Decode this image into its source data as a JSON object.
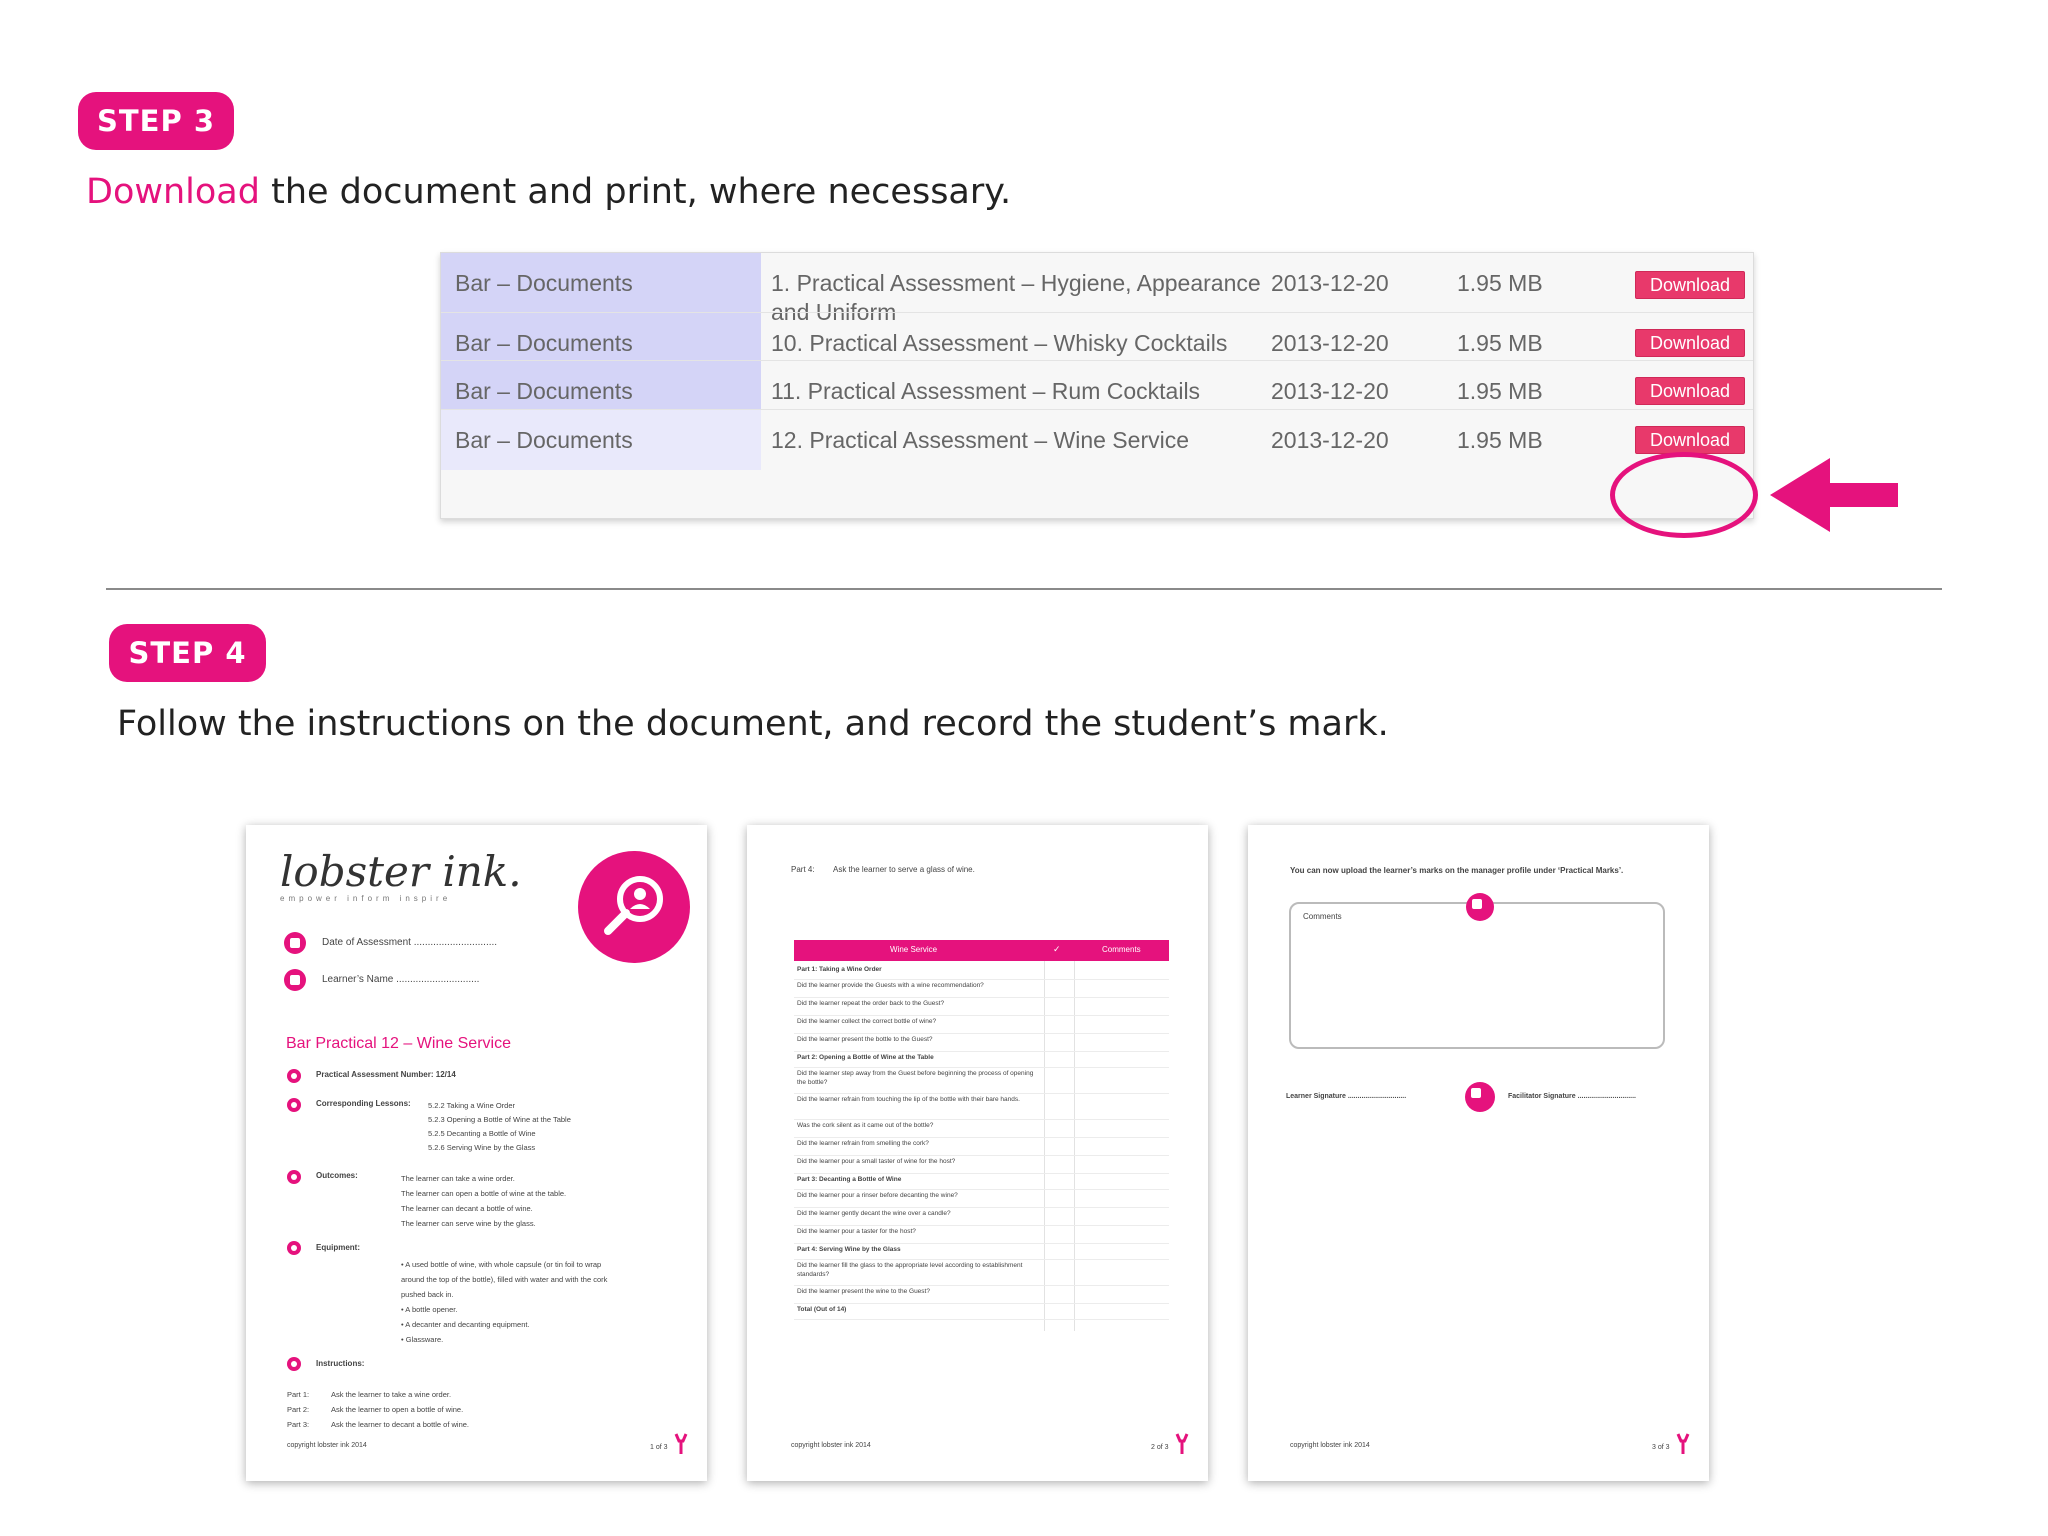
{
  "step3": {
    "badge": "STEP 3",
    "instruction_link": "Download",
    "instruction_rest": " the document and print, where necessary."
  },
  "table": {
    "rows": [
      {
        "category": "Bar – Documents",
        "title": "1. Practical Assessment – Hygiene, Appearance and Uniform",
        "date": "2013-12-20",
        "size": "1.95 MB",
        "button": "Download"
      },
      {
        "category": "Bar – Documents",
        "title": "10. Practical Assessment – Whisky Cocktails",
        "date": "2013-12-20",
        "size": "1.95 MB",
        "button": "Download"
      },
      {
        "category": "Bar – Documents",
        "title": "11. Practical Assessment – Rum Cocktails",
        "date": "2013-12-20",
        "size": "1.95 MB",
        "button": "Download"
      },
      {
        "category": "Bar – Documents",
        "title": "12. Practical Assessment – Wine Service",
        "date": "2013-12-20",
        "size": "1.95 MB",
        "button": "Download"
      }
    ]
  },
  "step4": {
    "badge": "STEP 4",
    "instruction": "Follow the instructions on the document, and record the student’s mark."
  },
  "page1": {
    "logo_text": "lobster ink.",
    "logo_tagline": "empower inform inspire",
    "date_label": "Date of Assessment ..............................",
    "name_label": "Learner’s Name ..............................",
    "doc_title": "Bar Practical 12 – Wine Service",
    "assessment_number": "Practical Assessment Number: 12/14",
    "corresponding_label": "Corresponding Lessons:",
    "lessons": [
      "5.2.2 Taking a Wine Order",
      "5.2.3 Opening a Bottle of Wine at the Table",
      "5.2.5 Decanting a Bottle of Wine",
      "5.2.6 Serving Wine by the Glass"
    ],
    "outcomes_label": "Outcomes:",
    "outcomes": [
      "The learner can take a wine order.",
      "The learner can open a bottle of wine at the table.",
      "The learner can decant a bottle of wine.",
      "The learner can serve wine by the glass."
    ],
    "equipment_label": "Equipment:",
    "equipment": [
      "• A used bottle of wine, with whole capsule (or tin foil to wrap",
      "around the top of the bottle), filled with water and with the cork",
      "pushed back in.",
      "• A bottle opener.",
      "• A decanter and decanting equipment.",
      "• Glassware."
    ],
    "instructions_label": "Instructions:",
    "instructions": [
      {
        "part": "Part 1:",
        "text": "Ask the learner to take a wine order."
      },
      {
        "part": "Part 2:",
        "text": "Ask the learner to open a bottle of wine."
      },
      {
        "part": "Part 3:",
        "text": "Ask the learner to decant a bottle of wine."
      }
    ],
    "copyright": "copyright lobster ink 2014",
    "page_num": "1 of 3"
  },
  "page2": {
    "part4_label": "Part 4:",
    "part4_text": "Ask the learner to serve a glass of wine.",
    "col1": "Wine Service",
    "col2": "✓",
    "col3": "Comments",
    "rows": [
      {
        "text": "Part 1: Taking a Wine Order",
        "bold": true
      },
      {
        "text": "Did the learner provide the Guests with a wine recommendation?",
        "bold": false
      },
      {
        "text": "Did the learner repeat the order back to the Guest?",
        "bold": false
      },
      {
        "text": "Did the learner collect the correct bottle of wine?",
        "bold": false
      },
      {
        "text": "Did the learner present the bottle to the Guest?",
        "bold": false
      },
      {
        "text": "Part 2: Opening a Bottle of Wine at the Table",
        "bold": true
      },
      {
        "text": "Did the learner step away from the Guest before beginning the process of opening the bottle?",
        "bold": false
      },
      {
        "text": "Did the learner refrain from touching the lip of the bottle with their bare hands.",
        "bold": false
      },
      {
        "text": "Was the cork silent as it came out of the bottle?",
        "bold": false
      },
      {
        "text": "Did the learner refrain from smelling the cork?",
        "bold": false
      },
      {
        "text": "Did the learner pour a small taster of wine for the host?",
        "bold": false
      },
      {
        "text": "Part 3: Decanting a Bottle of Wine",
        "bold": true
      },
      {
        "text": "Did the learner pour a rinser before decanting the wine?",
        "bold": false
      },
      {
        "text": "Did the learner gently decant the wine over a candle?",
        "bold": false
      },
      {
        "text": "Did the learner pour a taster for the host?",
        "bold": false
      },
      {
        "text": "Part 4: Serving Wine by the Glass",
        "bold": true
      },
      {
        "text": "Did the learner fill the glass to the appropriate level according to establishment standards?",
        "bold": false
      },
      {
        "text": "Did the learner present the wine to the Guest?",
        "bold": false
      },
      {
        "text": "Total (Out of 14)",
        "bold": true
      }
    ],
    "copyright": "copyright lobster ink 2014",
    "page_num": "2 of 3"
  },
  "page3": {
    "upload_text": "You can now upload the learner’s marks on the manager profile under ‘Practical Marks’.",
    "comments_label": "Comments",
    "learner_sig": "Learner Signature ..............................",
    "facilitator_sig": "Facilitator Signature ..............................",
    "copyright": "copyright lobster ink 2014",
    "page_num": "3 of 3"
  },
  "colors": {
    "accent": "#e5127d",
    "download_button": "#e8396b",
    "table_category_bg": "#d4d4f7"
  }
}
